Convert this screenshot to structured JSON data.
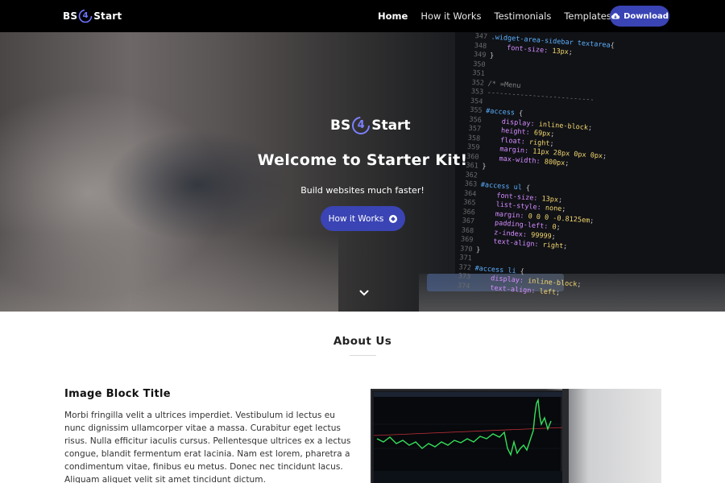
{
  "nav": {
    "brand": {
      "left": "BS",
      "middle": "4",
      "right": "Start"
    },
    "links": [
      {
        "label": "Home",
        "active": true
      },
      {
        "label": "How it Works",
        "active": false
      },
      {
        "label": "Testimonials",
        "active": false
      },
      {
        "label": "Templates",
        "active": false,
        "dropdown": true
      }
    ],
    "download_label": "Download",
    "download_icon": "cloud-download-icon"
  },
  "hero": {
    "logo": {
      "left": "BS",
      "middle": "4",
      "right": "Start"
    },
    "title": "Welcome to Starter Kit!",
    "subtitle": "Build websites much faster!",
    "cta_label": "How it Works",
    "cta_icon": "compass-icon",
    "scroll_icon": "chevron-down-icon"
  },
  "about": {
    "title": "About Us",
    "block_title": "Image Block Title",
    "block_text": "Morbi fringilla velit a ultrices imperdiet. Vestibulum id lectus eu nunc dignissim ullamcorper vitae a massa. Curabitur eget lectus risus. Nulla efficitur iaculis cursus. Pellentesque ultrices ex a lectus congue, blandit fermentum erat lacinia. Nam est lorem, pharetra a condimentum vitae, finibus eu metus. Donec nec tincidunt lacus. Aliquam aliquet velit sit amet tincidunt dictum."
  },
  "colors": {
    "accent": "#3a44b4",
    "nav_bg": "#000000",
    "brand_accent": "#6f74ff"
  }
}
